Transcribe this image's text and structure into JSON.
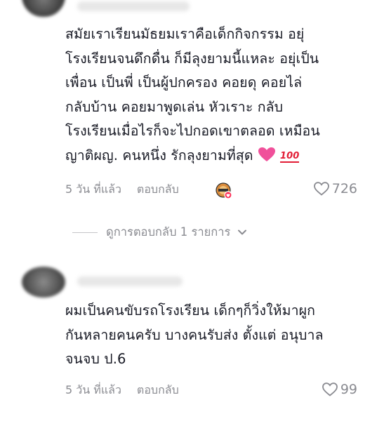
{
  "comments": [
    {
      "text_lines": [
        "สมัยเราเรียนมัธยมเราคือเด็กกิจกรรม อยุ่",
        "โรงเรียนจนดึกดื่น ก็มีลุงยามนี้แหละ อยุ่เป็น",
        "เพื่อน เป็นพี่ เป็นผู้ปกครอง คอยดุ คอยไล่",
        "กลับบ้าน คอยมาพูดเล่น หัวเราะ กลับ",
        "โรงเรียนเมื่อไรก็จะไปกอดเขาตลอด เหมือน",
        "ญาติผญ. คนหนึ่ง รักลุงยามที่สุด "
      ],
      "time": "5 วัน ที่แล้ว",
      "reply_label": "ตอบกลับ",
      "likes": "726"
    },
    {
      "text_lines": [
        "ผมเป็นคนขับรถโรงเรียน เด็กๆก็วิ่งให้มาผูก",
        "กันหลายคนครับ บางคนรับส่ง ตั้งแต่ อนุบาล",
        "จนจบ ป.6"
      ],
      "time": "5 วัน ที่แล้ว",
      "reply_label": "ตอบกลับ",
      "likes": "99"
    }
  ],
  "view_replies_label": "ดูการตอบกลับ 1 รายการ",
  "emoji": {
    "hundred": "100"
  },
  "colors": {
    "heart_emoji": "#f0509a",
    "muted": "#8a8b91"
  }
}
